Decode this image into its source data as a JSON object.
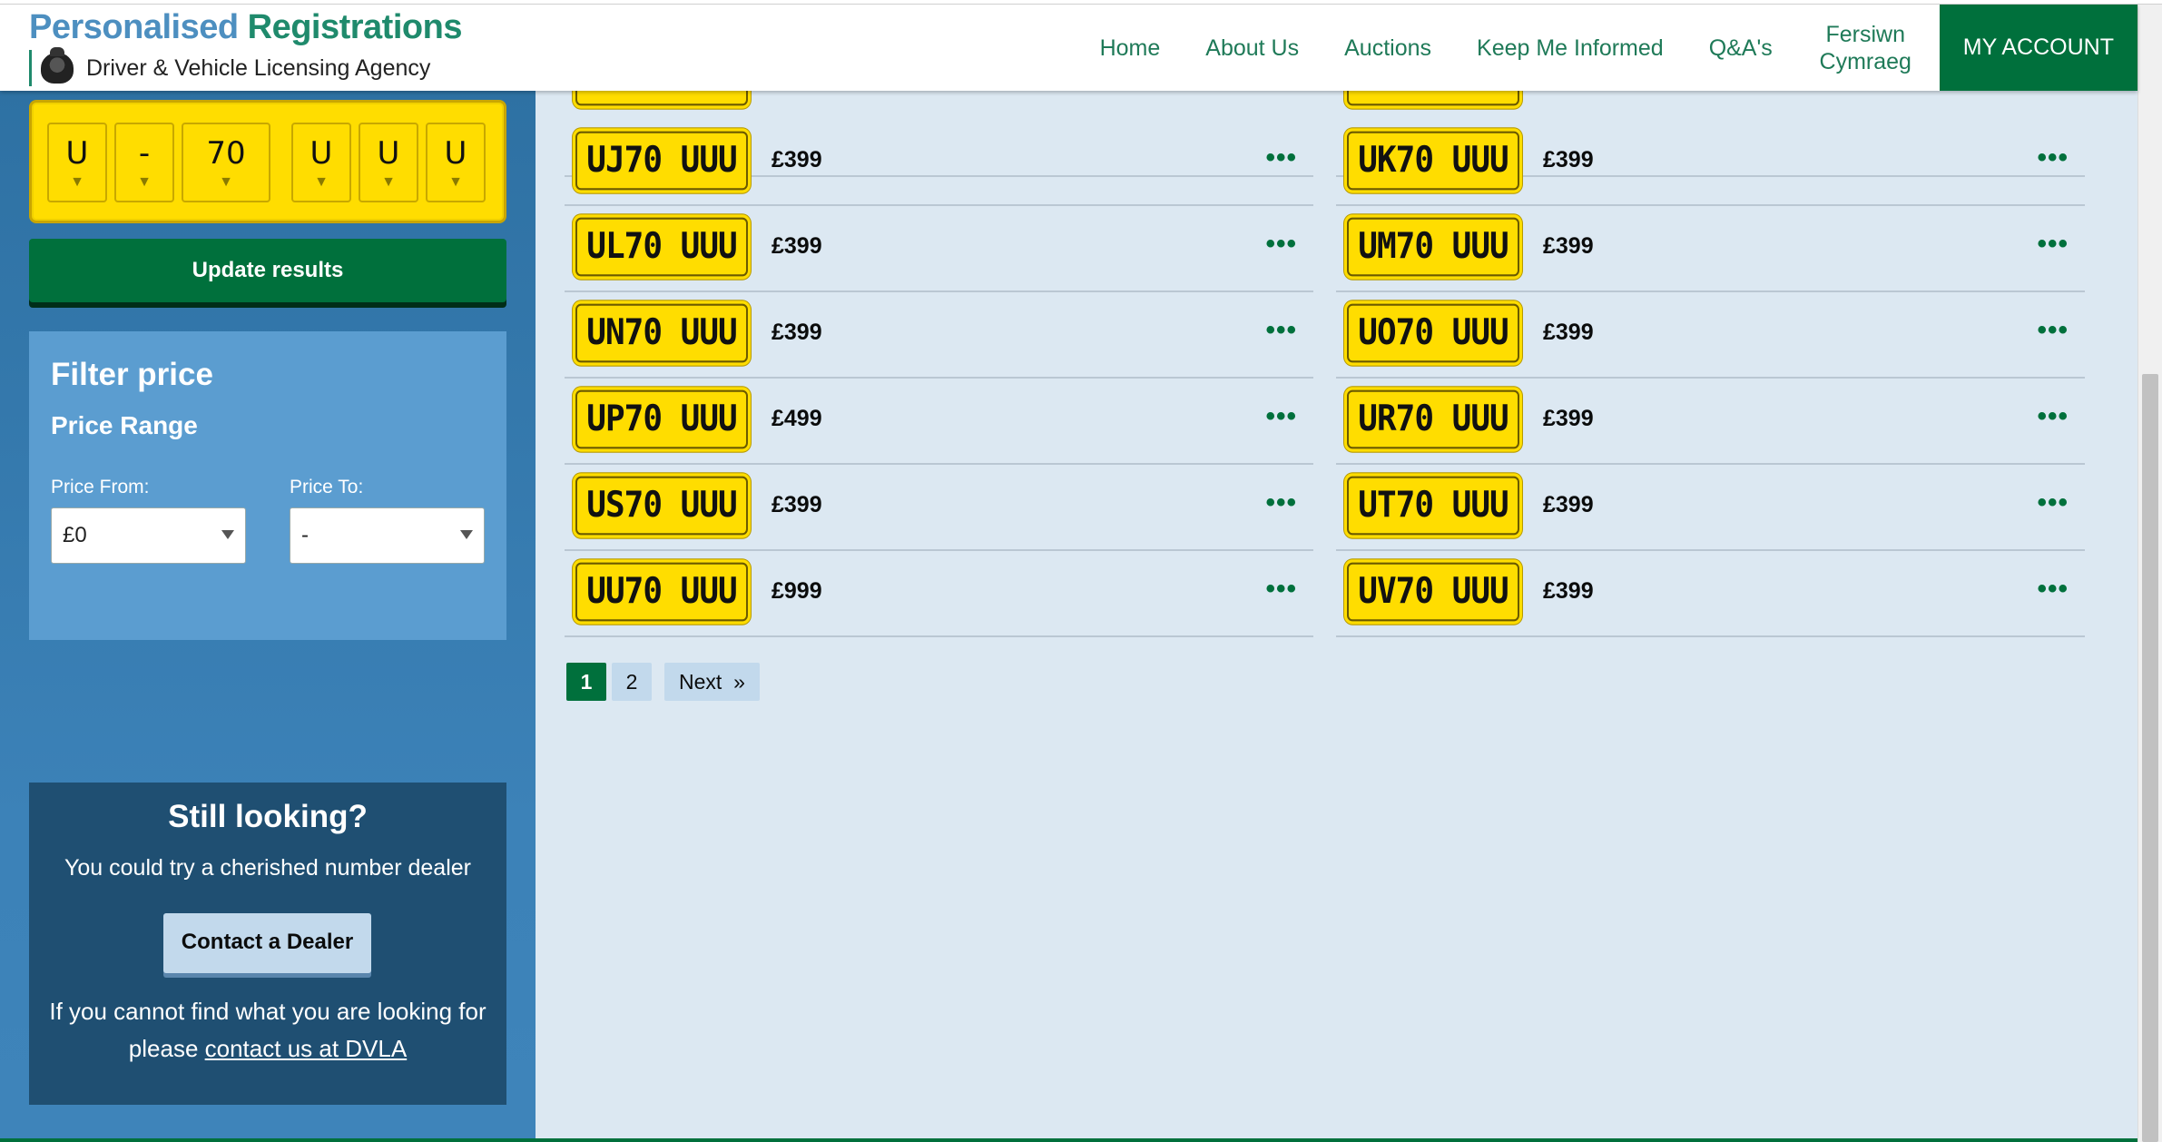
{
  "header": {
    "brand_word1": "Personalised",
    "brand_word2": "Registrations",
    "agency": "Driver & Vehicle Licensing Agency",
    "nav": [
      "Home",
      "About Us",
      "Auctions",
      "Keep Me Informed",
      "Q&A's"
    ],
    "welsh_line1": "Fersiwn",
    "welsh_line2": "Cymraeg",
    "account": "MY ACCOUNT"
  },
  "plate_picker": {
    "chars": [
      "U",
      "-",
      "70",
      "U",
      "U",
      "U"
    ],
    "arrow": "▼"
  },
  "update_button": "Update results",
  "filter": {
    "title": "Filter price",
    "subtitle": "Price Range",
    "from_label": "Price From:",
    "from_value": "£0",
    "to_label": "Price To:",
    "to_value": "-"
  },
  "still_looking": {
    "title": "Still looking?",
    "text": "You could try a cherished number dealer",
    "button": "Contact a Dealer",
    "foot_line1": "If you cannot find what you are looking for",
    "foot_prefix": "please ",
    "foot_link": "contact us at DVLA"
  },
  "results": {
    "more_glyph": "•••",
    "left": [
      {
        "reg": "UJ70 UUU",
        "price": "£399"
      },
      {
        "reg": "UL70 UUU",
        "price": "£399"
      },
      {
        "reg": "UN70 UUU",
        "price": "£399"
      },
      {
        "reg": "UP70 UUU",
        "price": "£499"
      },
      {
        "reg": "US70 UUU",
        "price": "£399"
      },
      {
        "reg": "UU70 UUU",
        "price": "£999"
      }
    ],
    "right": [
      {
        "reg": "UK70 UUU",
        "price": "£399"
      },
      {
        "reg": "UM70 UUU",
        "price": "£399"
      },
      {
        "reg": "UO70 UUU",
        "price": "£399"
      },
      {
        "reg": "UR70 UUU",
        "price": "£399"
      },
      {
        "reg": "UT70 UUU",
        "price": "£399"
      },
      {
        "reg": "UV70 UUU",
        "price": "£399"
      }
    ]
  },
  "pagination": {
    "pages": [
      "1",
      "2"
    ],
    "current": "1",
    "next": "Next",
    "next_glyph": "»"
  }
}
